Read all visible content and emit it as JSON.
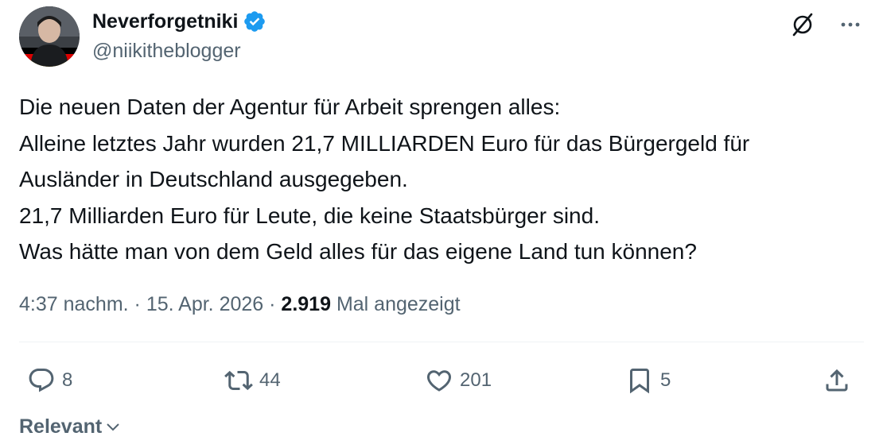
{
  "author": {
    "display_name": "Neverforgetniki",
    "handle": "@niikitheblogger",
    "verified": true,
    "verified_color": "#1d9bf0"
  },
  "tweet": {
    "lines": [
      "Die neuen Daten der Agentur für Arbeit sprengen alles:",
      "Alleine letztes Jahr wurden 21,7 MILLIARDEN Euro für das Bürgergeld für",
      "Ausländer in Deutschland ausgegeben.",
      "21,7 Milliarden Euro für Leute, die keine Staatsbürger sind.",
      "Was hätte man von dem Geld alles für das eigene Land tun können?"
    ]
  },
  "meta": {
    "time": "4:37 nachm.",
    "separator": "·",
    "date": "15. Apr. 2026",
    "views_count": "2.919",
    "views_label": "Mal angezeigt"
  },
  "actions": {
    "replies": "8",
    "reposts": "44",
    "likes": "201",
    "bookmarks": "5"
  },
  "sort": {
    "label": "Relevant"
  },
  "icons": {
    "top": [
      "grok-icon",
      "more-icon"
    ],
    "actions": [
      "reply-icon",
      "repost-icon",
      "like-icon",
      "bookmark-icon",
      "share-icon"
    ]
  },
  "colors": {
    "text": "#0f1419",
    "secondary": "#536471",
    "divider": "#eff3f4",
    "flag_black": "#000000",
    "flag_red": "#dd0000",
    "flag_gold": "#ffce00"
  }
}
